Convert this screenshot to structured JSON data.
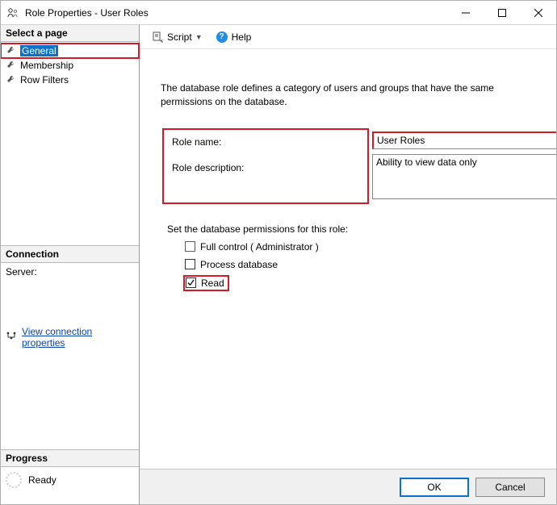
{
  "window": {
    "title": "Role Properties - User Roles"
  },
  "left": {
    "select_page": "Select a page",
    "pages": [
      {
        "label": "General",
        "selected": true
      },
      {
        "label": "Membership",
        "selected": false
      },
      {
        "label": "Row Filters",
        "selected": false
      }
    ],
    "connection_head": "Connection",
    "server_label": "Server:",
    "view_conn_link": "View connection properties",
    "progress_head": "Progress",
    "progress_status": "Ready"
  },
  "toolbar": {
    "script_label": "Script",
    "help_label": "Help"
  },
  "content": {
    "description": "The database role defines a category of users and groups that have the same permissions on the database.",
    "role_name_label": "Role name:",
    "role_desc_label": "Role description:",
    "role_name_value": "User Roles",
    "role_desc_value": "Ability to view data only",
    "perms_title": "Set the database permissions for this role:",
    "perms": [
      {
        "label": "Full control ( Administrator )",
        "checked": false,
        "blue": true
      },
      {
        "label": "Process database",
        "checked": false,
        "blue": false
      },
      {
        "label": "Read",
        "checked": true,
        "blue": false,
        "highlight": true
      }
    ]
  },
  "footer": {
    "ok": "OK",
    "cancel": "Cancel"
  }
}
